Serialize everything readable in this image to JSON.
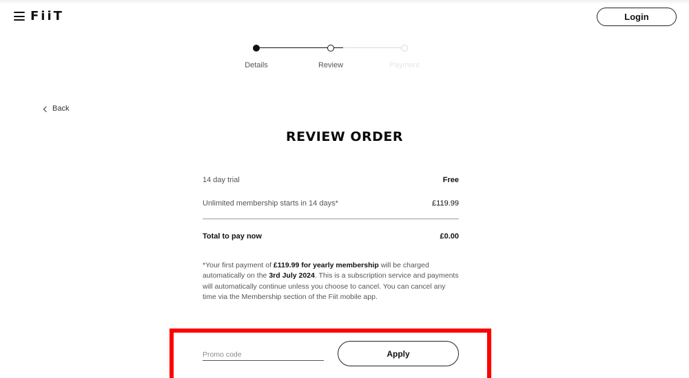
{
  "header": {
    "logo": "FiiT",
    "login_label": "Login"
  },
  "stepper": {
    "steps": [
      {
        "label": "Details",
        "state": "completed"
      },
      {
        "label": "Review",
        "state": "current"
      },
      {
        "label": "Payment",
        "state": "upcoming"
      }
    ]
  },
  "nav": {
    "back_label": "Back"
  },
  "page": {
    "title": "REVIEW ORDER"
  },
  "order": {
    "items": [
      {
        "label": "14 day trial",
        "value": "Free"
      },
      {
        "label": "Unlimited membership starts in 14 days*",
        "value": "£119.99"
      }
    ],
    "total": {
      "label": "Total to pay now",
      "value": "£0.00"
    }
  },
  "notice": {
    "part1": "*Your first payment of ",
    "bold1": "£119.99 for yearly membership",
    "part2": " will be charged automatically on the ",
    "bold2": "3rd July 2024",
    "part3": ". This is a subscription service and payments will automatically continue unless you choose to cancel. You can cancel any time via the Membership section of the Fiit mobile app."
  },
  "promo": {
    "placeholder": "Promo code",
    "value": "",
    "apply_label": "Apply"
  },
  "colors": {
    "highlight": "#ff0000",
    "text": "#111111",
    "muted": "#555555"
  }
}
